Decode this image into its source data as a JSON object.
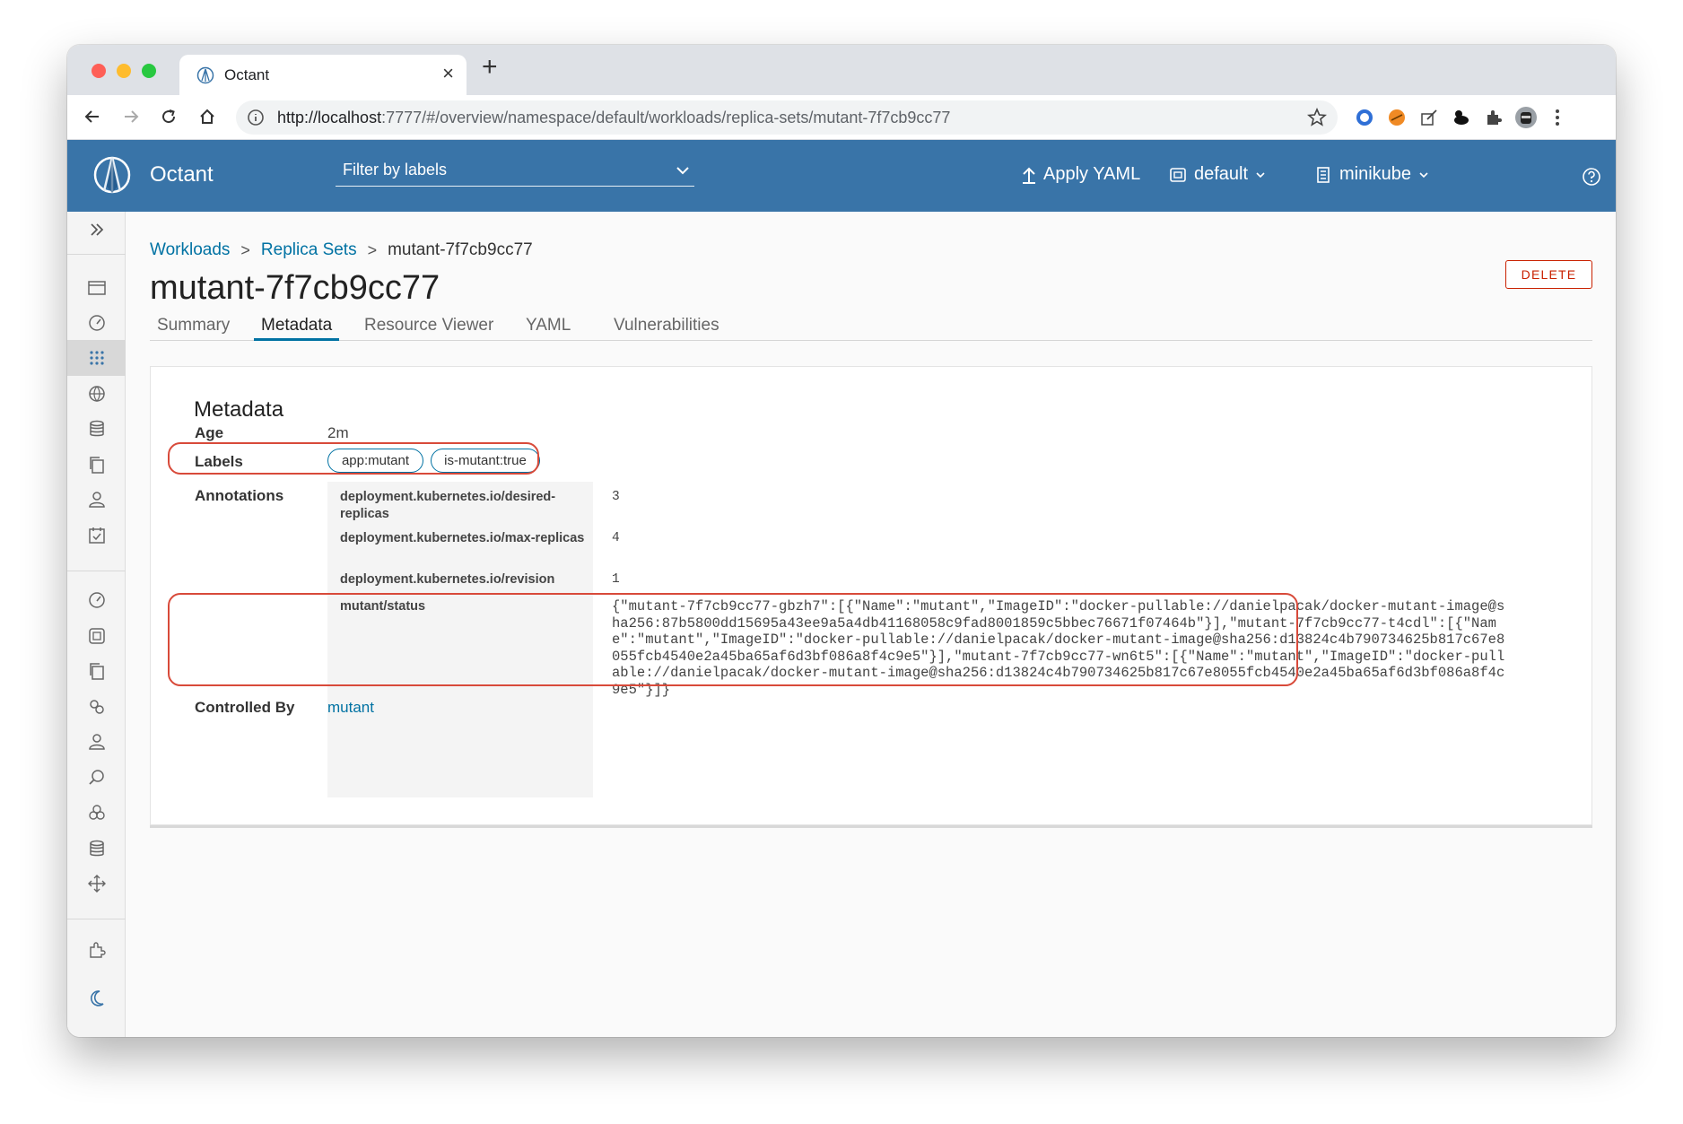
{
  "browser": {
    "tab_title": "Octant",
    "tab_close": "×",
    "new_tab": "+",
    "url_host": "http://localhost",
    "url_rest": ":7777/#/overview/namespace/default/workloads/replica-sets/mutant-7f7cb9cc77"
  },
  "header": {
    "app_name": "Octant",
    "filter_placeholder": "Filter by labels",
    "apply_yaml": "Apply YAML",
    "namespace": "default",
    "context": "minikube"
  },
  "breadcrumb": [
    {
      "label": "Workloads"
    },
    {
      "label": "Replica Sets"
    },
    {
      "label": "mutant-7f7cb9cc77"
    }
  ],
  "page": {
    "title": "mutant-7f7cb9cc77",
    "delete_label": "DELETE"
  },
  "tabs": [
    {
      "label": "Summary"
    },
    {
      "label": "Metadata"
    },
    {
      "label": "Resource Viewer"
    },
    {
      "label": "YAML"
    },
    {
      "label": "Vulnerabilities"
    }
  ],
  "metadata": {
    "card_title": "Metadata",
    "age_label": "Age",
    "age_value": "2m",
    "labels_label": "Labels",
    "labels": [
      "app:mutant",
      "is-mutant:true"
    ],
    "annotations_label": "Annotations",
    "annotations": [
      {
        "key": "deployment.kubernetes.io/desired-replicas",
        "value": "3"
      },
      {
        "key": "deployment.kubernetes.io/max-replicas",
        "value": "4"
      },
      {
        "key": "deployment.kubernetes.io/revision",
        "value": "1"
      },
      {
        "key": "mutant/status",
        "value": "{\"mutant-7f7cb9cc77-gbzh7\":[{\"Name\":\"mutant\",\"ImageID\":\"docker-pullable://danielpacak/docker-mutant-image@sha256:87b5800dd15695a43ee9a5a4db41168058c9fad8001859c5bbec76671f07464b\"}],\"mutant-7f7cb9cc77-t4cdl\":[{\"Name\":\"mutant\",\"ImageID\":\"docker-pullable://danielpacak/docker-mutant-image@sha256:d13824c4b790734625b817c67e8055fcb4540e2a45ba65af6d3bf086a8f4c9e5\"}],\"mutant-7f7cb9cc77-wn6t5\":[{\"Name\":\"mutant\",\"ImageID\":\"docker-pullable://danielpacak/docker-mutant-image@sha256:d13824c4b790734625b817c67e8055fcb4540e2a45ba65af6d3bf086a8f4c9e5\"}]}"
      }
    ],
    "controlled_by_label": "Controlled By",
    "controlled_by_value": "mutant"
  },
  "colors": {
    "header_bg": "#3974a8",
    "link": "#0072a3",
    "danger": "#c92100",
    "highlight": "#d84a3a"
  }
}
